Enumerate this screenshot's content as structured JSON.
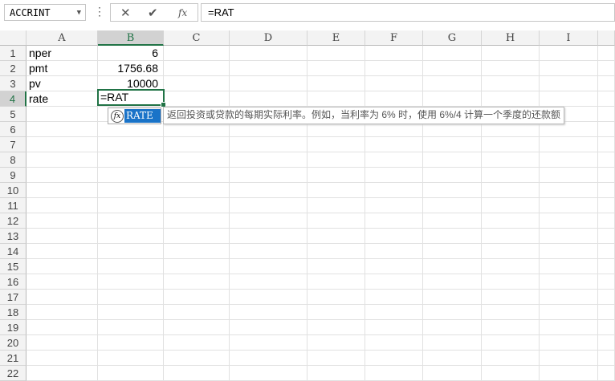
{
  "namebox": {
    "value": "ACCRINT",
    "arrow": "▼"
  },
  "formula_bar": {
    "more": "⋮",
    "cancel": "✕",
    "enter": "✔",
    "fx": "fx",
    "value": "=RAT"
  },
  "columns": [
    "A",
    "B",
    "C",
    "D",
    "E",
    "F",
    "G",
    "H",
    "I"
  ],
  "rows": [
    "1",
    "2",
    "3",
    "4",
    "5",
    "6",
    "7",
    "8",
    "9",
    "10",
    "11",
    "12",
    "13",
    "14",
    "15",
    "16",
    "17",
    "18",
    "19",
    "20",
    "21",
    "22"
  ],
  "cells": [
    {
      "row": 1,
      "A": "nper",
      "B": "6"
    },
    {
      "row": 2,
      "A": "pmt",
      "B": "1756.68"
    },
    {
      "row": 3,
      "A": "pv",
      "B": "10000"
    },
    {
      "row": 4,
      "A": "rate",
      "B": ""
    }
  ],
  "selected": {
    "column": "B",
    "row": "4"
  },
  "editing_value": "=RAT",
  "autocomplete": {
    "icon": "fx",
    "item": "RATE"
  },
  "tooltip": "返回投资或贷款的每期实际利率。例如，当利率为 6% 时，使用 6%/4 计算一个季度的还款额"
}
